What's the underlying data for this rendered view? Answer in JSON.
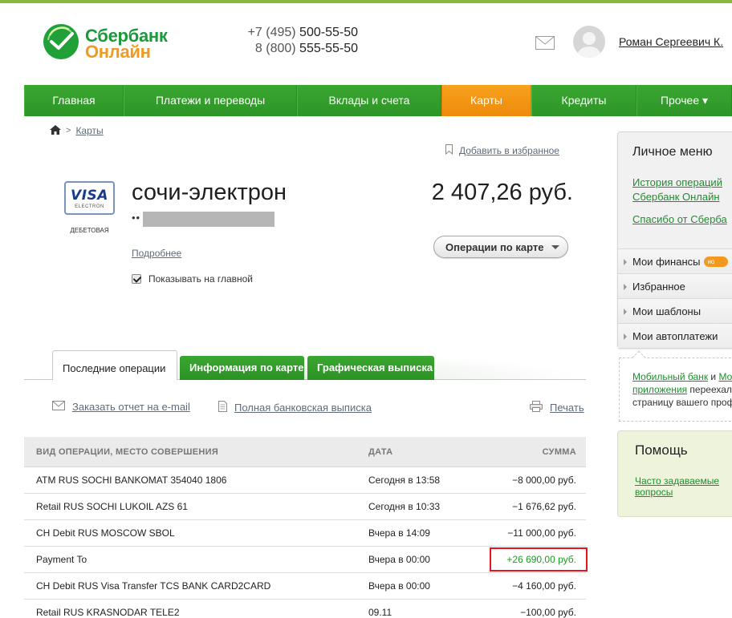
{
  "brand": {
    "line1": "Сбербанк",
    "line2": "Онлайн",
    "colors": {
      "green": "#1a9a3b",
      "orange": "#f29a1f"
    }
  },
  "header": {
    "phone1_prefix": "+7 (495) ",
    "phone1_number": "500-55-50",
    "phone2_prefix": "8 (800) ",
    "phone2_number": "555-55-50",
    "user_name": "Роман Сергеевич К.",
    "mail_icon": "envelope-icon",
    "avatar_icon": "user-avatar-icon"
  },
  "nav": {
    "items": [
      {
        "label": "Главная"
      },
      {
        "label": "Платежи и переводы"
      },
      {
        "label": "Вклады и счета"
      },
      {
        "label": "Карты"
      },
      {
        "label": "Кредиты"
      },
      {
        "label": "Прочее ▾"
      }
    ],
    "active": "Карты",
    "colors": {
      "nav_green": "#339e2b",
      "active_orange": "#f29a1f"
    }
  },
  "breadcrumb": {
    "home_icon": "home-icon",
    "current": "Карты"
  },
  "favorites": {
    "label": "Добавить в избранное"
  },
  "card": {
    "brand_text": "VISA",
    "brand_sub": "ELECTRON",
    "type": "ДЕБЕТОВАЯ",
    "name": "сочи-электрон",
    "number_dots": "••",
    "balance": "2 407,26 руб.",
    "operations_button": "Операции по карте",
    "details_link": "Подробнее",
    "show_on_main": "Показывать на главной",
    "show_on_main_checked": true
  },
  "tabs": [
    {
      "label": "Последние операции"
    },
    {
      "label": "Информация по карте"
    },
    {
      "label": "Графическая выписка"
    }
  ],
  "actions": {
    "email_report": "Заказать отчет на e-mail",
    "full_statement": "Полная банковская выписка",
    "print": "Печать"
  },
  "table": {
    "headers": {
      "operation": "ВИД ОПЕРАЦИИ, МЕСТО СОВЕРШЕНИЯ",
      "date": "ДАТА",
      "amount": "СУММА"
    },
    "rows": [
      {
        "operation": "ATM RUS SOCHI BANKOMAT 354040 1806",
        "date": "Сегодня в 13:58",
        "amount": "−8 000,00 руб."
      },
      {
        "operation": "Retail RUS SOCHI LUKOIL AZS 61",
        "date": "Сегодня в 10:33",
        "amount": "−1 676,62 руб."
      },
      {
        "operation": "CH Debit RUS MOSCOW SBOL",
        "date": "Вчера в 14:09",
        "amount": "−11 000,00 руб."
      },
      {
        "operation": "Payment To",
        "date": "Вчера в 00:00",
        "amount": "+26 690,00 руб."
      },
      {
        "operation": "CH Debit RUS Visa Transfer TCS BANK CARD2CARD",
        "date": "Вчера в 00:00",
        "amount": "−4 160,00 руб."
      },
      {
        "operation": "Retail RUS KRASNODAR TELE2",
        "date": "09.11",
        "amount": "−100,00 руб."
      }
    ],
    "colors": {
      "positive": "#1e9a22",
      "highlight": "#e4151f"
    }
  },
  "sidebar": {
    "title": "Личное меню",
    "link1_line1": "История операций",
    "link1_line2": "Сбербанк Онлайн",
    "link2": "Спасибо от Сберба",
    "items": [
      {
        "label": "Мои финансы",
        "badge": "но"
      },
      {
        "label": "Избранное"
      },
      {
        "label": "Мои шаблоны"
      },
      {
        "label": "Мои автоплатежи"
      }
    ],
    "note": {
      "link_a": "Мобильный банк",
      "and": " и ",
      "link_b": "Мо",
      "link_c": "приложения",
      "text1": " переехал",
      "text2": "страницу вашего проф"
    },
    "help": {
      "title": "Помощь",
      "link_line1": "Часто задаваемые",
      "link_line2": "вопросы"
    }
  }
}
